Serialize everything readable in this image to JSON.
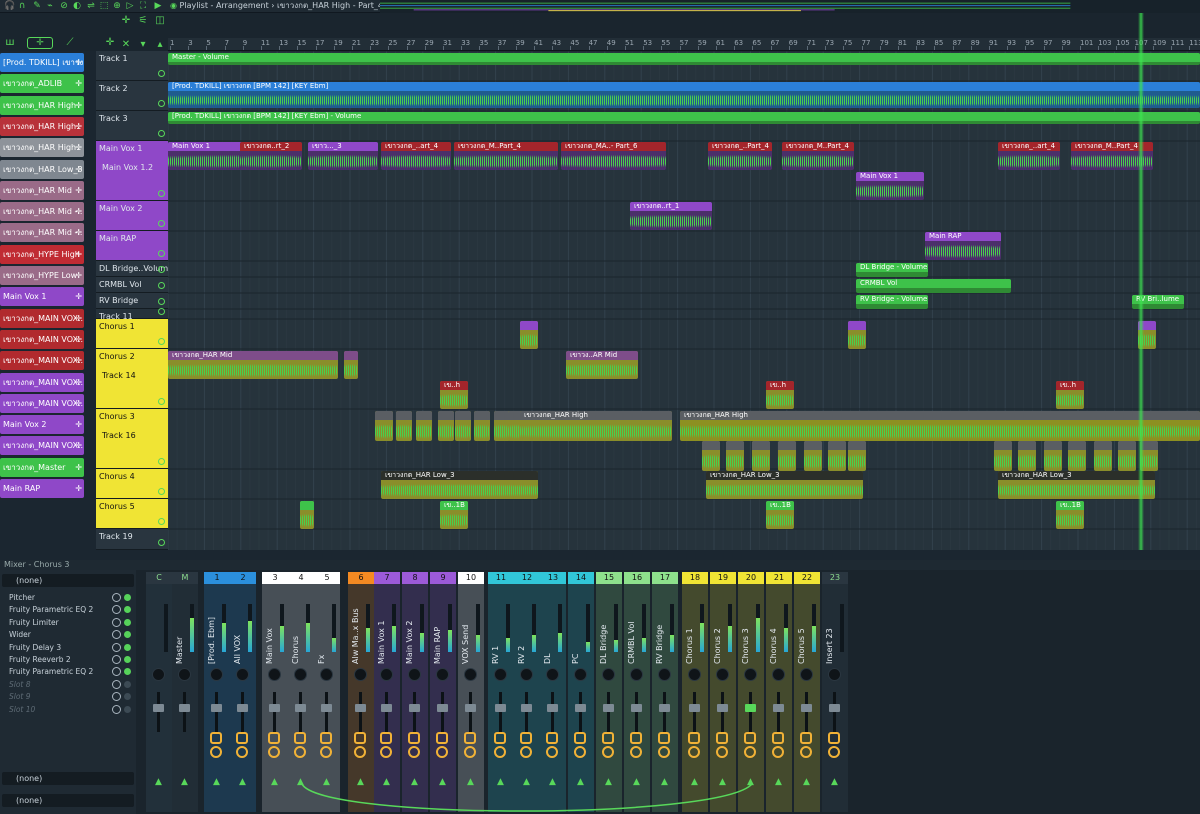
{
  "window": {
    "title": "Playlist - Arrangement",
    "breadcrumb": [
      "เขาวงกต_HAR High - Part_4"
    ],
    "separator": "›"
  },
  "ruler": {
    "bars": [
      "1",
      "3",
      "5",
      "7",
      "9",
      "11",
      "13",
      "15",
      "17",
      "19",
      "21",
      "23",
      "25",
      "27",
      "29",
      "31",
      "33",
      "35",
      "37",
      "39",
      "41",
      "43",
      "45",
      "47",
      "49",
      "51",
      "53",
      "55",
      "57",
      "59",
      "61",
      "63",
      "65",
      "67",
      "69",
      "71",
      "73",
      "75",
      "77",
      "79",
      "81",
      "83",
      "85",
      "87",
      "89",
      "91",
      "93",
      "95",
      "97",
      "99",
      "101",
      "103",
      "105",
      "107",
      "109",
      "111",
      "113"
    ]
  },
  "channels": [
    {
      "label": "[Prod. TDKILL] เขาวง",
      "color": "#2b7fd8"
    },
    {
      "label": "เขาวงกต_ADLIB",
      "color": "#3ec24a"
    },
    {
      "label": "เขาวงกต_HAR High",
      "color": "#3ec24a"
    },
    {
      "label": "เขาวงกต_HAR High..",
      "color": "#b8323a"
    },
    {
      "label": "เขาวงกต_HAR High..",
      "color": "#8e939a"
    },
    {
      "label": "เขาวงกต_HAR Low_3",
      "color": "#7f8790"
    },
    {
      "label": "เขาวงกต_HAR Mid",
      "color": "#9a6b88"
    },
    {
      "label": "เขาวงกต_HAR Mid -..",
      "color": "#9a6b88"
    },
    {
      "label": "เขาวงกต_HAR Mid -..",
      "color": "#9a6b88"
    },
    {
      "label": "เขาวงกต_HYPE High",
      "color": "#c02b33"
    },
    {
      "label": "เขาวงกต_HYPE Low",
      "color": "#9a6b88"
    },
    {
      "label": "Main Vox 1",
      "color": "#8f48c8"
    },
    {
      "label": "เขาวงกต_MAIN VOX..",
      "color": "#b12a2e"
    },
    {
      "label": "เขาวงกต_MAIN VOX..",
      "color": "#b12a2e"
    },
    {
      "label": "เขาวงกต_MAIN VOX..",
      "color": "#b12a2e"
    },
    {
      "label": "เขาวงกต_MAIN VOX..",
      "color": "#8f48c8"
    },
    {
      "label": "เขาวงกต_MAIN VOX..",
      "color": "#8f48c8"
    },
    {
      "label": "Main Vox 2",
      "color": "#8f48c8"
    },
    {
      "label": "เขาวงกต_MAIN VOX..",
      "color": "#8f48c8"
    },
    {
      "label": "เขาวงกต_Master",
      "color": "#3ec24a"
    },
    {
      "label": "Main RAP",
      "color": "#8f48c8"
    }
  ],
  "tracks": [
    {
      "label": "Track 1",
      "sub": ""
    },
    {
      "label": "Track 2",
      "sub": ""
    },
    {
      "label": "Track 3",
      "sub": ""
    },
    {
      "label": "Main Vox 1",
      "sub": "Main Vox 1.2"
    },
    {
      "label": "Main Vox 2",
      "sub": ""
    },
    {
      "label": "Main RAP",
      "sub": ""
    },
    {
      "label": "DL Bridge..Volume",
      "sub": ""
    },
    {
      "label": "CRMBL Vol",
      "sub": ""
    },
    {
      "label": "RV Bridge",
      "sub": ""
    },
    {
      "label": "Track 11",
      "sub": ""
    },
    {
      "label": "Chorus 1",
      "sub": ""
    },
    {
      "label": "Chorus 2",
      "sub": "Track 14"
    },
    {
      "label": "Chorus 3",
      "sub": "Track 16"
    },
    {
      "label": "Chorus 4",
      "sub": ""
    },
    {
      "label": "Chorus 5",
      "sub": ""
    },
    {
      "label": "Track 19",
      "sub": ""
    }
  ],
  "clips": {
    "master_vol": "Master - Volume",
    "prod_audio": "[Prod. TDKILL] เขาวงกต [BPM 142] [KEY Ebm]",
    "prod_vol": "[Prod. TDKILL] เขาวงกต [BPM 142] [KEY Ebm] - Volume",
    "mv1a": "Main Vox 1",
    "mv1b": "เขาวงกต..rt_2",
    "mv1c": "เขาว..._3",
    "mv1d": "เขาวงกต_..art_4",
    "mv1e": "เขาวงกต_M..Part_4",
    "mv1f": "เขาวงกต_MA..- Part_6",
    "mv1g": "เขาวงกต_..Part_4",
    "mv1h": "เขาวงกต_M..Part_4",
    "mv1i": "เขาวงกต_..art_4",
    "mv1j": "เขาวงกต_M..Part_4",
    "mv12": "Main Vox 1",
    "mv2": "เขาวงกต..rt_1",
    "rap": "Main RAP",
    "dlb": "DL Bridge - Volume",
    "crmbl": "CRMBL Vol",
    "rvb": "RV Bridge - Volume",
    "rvb2": "RV Bri..lume",
    "harmid": "เขาวงกต_HAR Mid",
    "harmid2": "เขาวง..AR Mid",
    "hh1": "เข..h",
    "hh2": "เข..h",
    "hh3": "เข..h",
    "harhigh": "เขาวงกต_HAR High",
    "harhigh2": "เขาวงกต_HAR High",
    "low1": "เขาวงกต_HAR Low_3",
    "low2": "เขาวงกต_HAR Low_3",
    "low3": "เขาวงกต_HAR Low_3",
    "lb1": "เข..1B",
    "lb2": "เข..1B",
    "lb3": "เข..1B"
  },
  "mixer": {
    "title": "Mixer - Chorus 3",
    "route": "(none)",
    "slots": [
      "Pitcher",
      "Fruity Parametric EQ 2",
      "Fruity Limiter",
      "Wider",
      "Fruity Delay 3",
      "Fruity Reeverb 2",
      "Fruity Parametric EQ 2",
      "Slot 8",
      "Slot 9",
      "Slot 10"
    ],
    "out1": "(none)",
    "out2": "(none)",
    "strips": [
      {
        "num": "C",
        "label": "",
        "color": "#2a3640"
      },
      {
        "num": "M",
        "label": "Master",
        "color": "#2a3640"
      },
      {
        "num": "1",
        "label": "[Prod. Ebm]",
        "color": "#2b8fdc"
      },
      {
        "num": "2",
        "label": "All VOX",
        "color": "#2b8fdc"
      },
      {
        "num": "3",
        "label": "Main Vox",
        "color": "#ffffff"
      },
      {
        "num": "4",
        "label": "Chorus",
        "color": "#ffffff"
      },
      {
        "num": "5",
        "label": "Fx",
        "color": "#ffffff"
      },
      {
        "num": "6",
        "label": "Alw Ma..x Bus",
        "color": "#f48a22"
      },
      {
        "num": "7",
        "label": "Main Vox 1",
        "color": "#9c5ad8"
      },
      {
        "num": "8",
        "label": "Main Vox 2",
        "color": "#9c5ad8"
      },
      {
        "num": "9",
        "label": "Main RAP",
        "color": "#9c5ad8"
      },
      {
        "num": "10",
        "label": "VOX Send",
        "color": "#ffffff"
      },
      {
        "num": "11",
        "label": "RV 1",
        "color": "#31c6d8"
      },
      {
        "num": "12",
        "label": "RV 2",
        "color": "#31c6d8"
      },
      {
        "num": "13",
        "label": "DL",
        "color": "#31c6d8"
      },
      {
        "num": "14",
        "label": "PC",
        "color": "#31c6d8"
      },
      {
        "num": "15",
        "label": "DL Bridge",
        "color": "#8ee08c"
      },
      {
        "num": "16",
        "label": "CRMBL Vol",
        "color": "#8ee08c"
      },
      {
        "num": "17",
        "label": "RV Bridge",
        "color": "#8ee08c"
      },
      {
        "num": "18",
        "label": "Chorus 1",
        "color": "#f0e434"
      },
      {
        "num": "19",
        "label": "Chorus 2",
        "color": "#f0e434"
      },
      {
        "num": "20",
        "label": "Chorus 3",
        "color": "#f0e434"
      },
      {
        "num": "21",
        "label": "Chorus 4",
        "color": "#f0e434"
      },
      {
        "num": "22",
        "label": "Chorus 5",
        "color": "#f0e434"
      },
      {
        "num": "23",
        "label": "Insert 23",
        "color": "#2a3640"
      }
    ]
  },
  "colors": {
    "accent": "#58d85a",
    "bg": "#1b2630"
  }
}
